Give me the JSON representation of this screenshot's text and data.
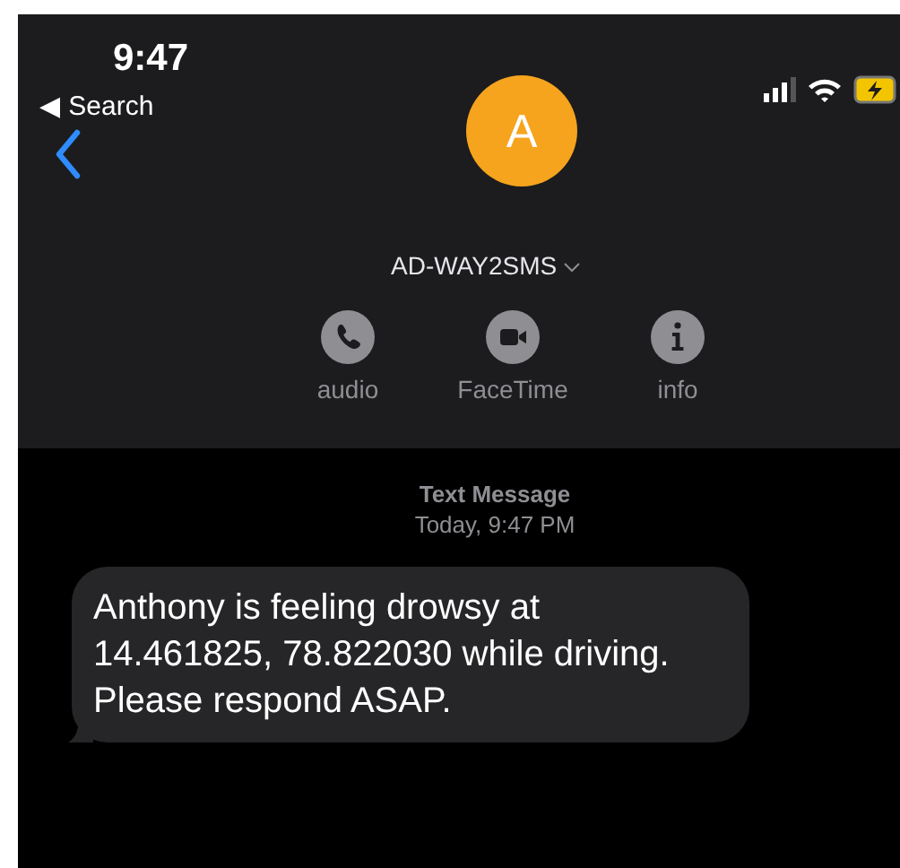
{
  "status_bar": {
    "time": "9:47",
    "back_link": "◀ Search"
  },
  "contact": {
    "initial": "A",
    "name": "AD-WAY2SMS"
  },
  "actions": [
    {
      "kind": "audio",
      "label": "audio"
    },
    {
      "kind": "video",
      "label": "FaceTime"
    },
    {
      "kind": "info",
      "label": "info"
    }
  ],
  "conversation": {
    "service": "Text Message",
    "timestamp": "Today, 9:47 PM",
    "messages": [
      {
        "text": "Anthony is feeling drowsy at 14.461825, 78.822030 while driving. Please respond ASAP."
      }
    ]
  }
}
